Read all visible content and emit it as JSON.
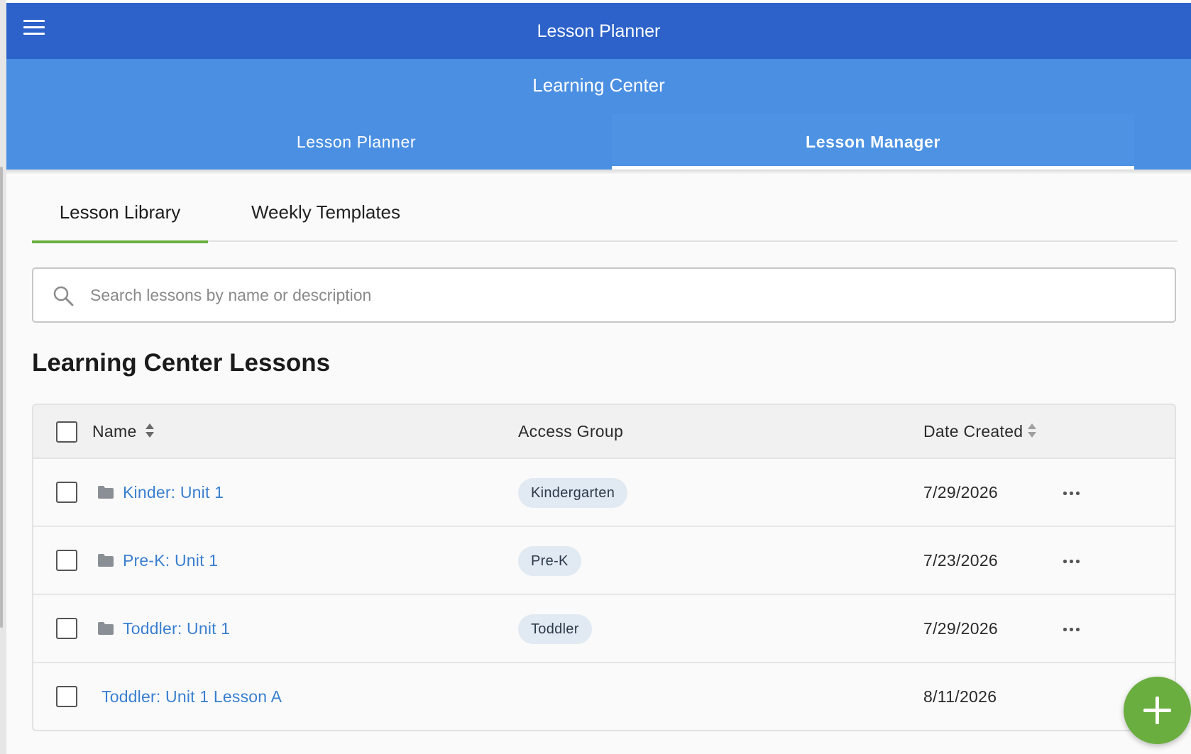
{
  "app": {
    "title": "Lesson Planner"
  },
  "subheader": {
    "title": "Learning Center",
    "tabs": [
      {
        "label": "Lesson Planner",
        "active": false
      },
      {
        "label": "Lesson Manager",
        "active": true
      }
    ]
  },
  "subtabs": [
    {
      "label": "Lesson Library",
      "active": true
    },
    {
      "label": "Weekly Templates",
      "active": false
    }
  ],
  "search": {
    "placeholder": "Search lessons by name or description",
    "value": ""
  },
  "section": {
    "title": "Learning Center Lessons"
  },
  "table": {
    "columns": {
      "name": "Name",
      "access_group": "Access Group",
      "date_created": "Date Created"
    },
    "rows": [
      {
        "name": "Kinder: Unit 1",
        "type": "folder",
        "access_group": "Kindergarten",
        "date": "7/29/2026",
        "checked": false
      },
      {
        "name": "Pre-K: Unit 1",
        "type": "folder",
        "access_group": "Pre-K",
        "date": "7/23/2026",
        "checked": false
      },
      {
        "name": "Toddler: Unit 1",
        "type": "folder",
        "access_group": "Toddler",
        "date": "7/29/2026",
        "checked": false
      },
      {
        "name": "Toddler: Unit 1 Lesson A",
        "type": "lesson",
        "access_group": "",
        "date": "8/11/2026",
        "checked": false
      }
    ]
  },
  "icons": {
    "menu": "hamburger-menu-icon",
    "search": "search-icon",
    "sort": "sort-icon",
    "folder": "folder-icon",
    "more": "more-horizontal-icon",
    "add": "plus-icon"
  },
  "colors": {
    "topbar": "#2c62c9",
    "subheader": "#4a8fe2",
    "accent_green": "#6aae3f",
    "link_blue": "#3a7fd0",
    "badge_bg": "#e1e9f2"
  }
}
